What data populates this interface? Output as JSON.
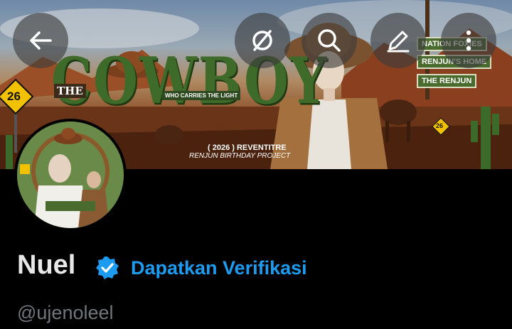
{
  "banner": {
    "title_art": "COWBOY",
    "the_tag": "THE",
    "subtitle_tag": "WHO CARRIES THE LIGHT",
    "project_line1": "( 2026 ) REVENTITRE",
    "project_line2": "RENJUN BIRTHDAY PROJECT",
    "road_sign_number": "26",
    "small_sign_number": "26",
    "wood_signs": [
      "NATION FOXIES",
      "RENJUN'S HOME",
      "THE RENJUN"
    ]
  },
  "topbar": {
    "back_icon": "arrow-left-icon",
    "grok_icon": "grok-icon",
    "search_icon": "search-icon",
    "edit_icon": "pencil-icon",
    "more_icon": "more-vertical-icon"
  },
  "profile": {
    "name": "Nuel",
    "verification_label": "Dapatkan Verifikasi",
    "handle": "@ujenoleel",
    "accent_color": "#1d9bf0"
  }
}
